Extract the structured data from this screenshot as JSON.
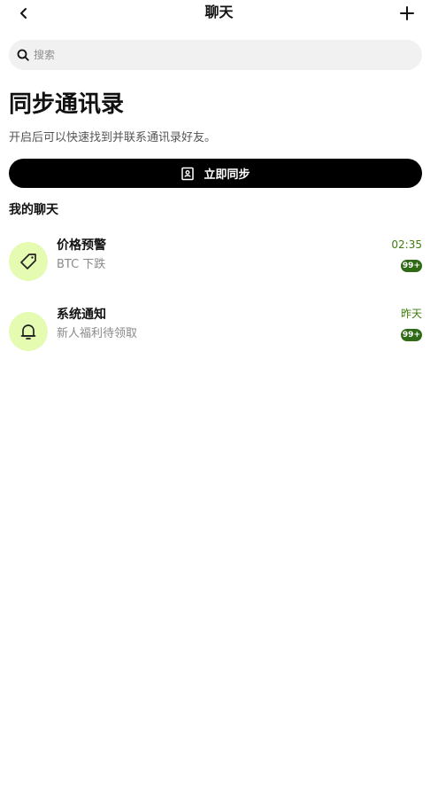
{
  "header": {
    "title": "聊天",
    "back_icon": "chevron-left-icon",
    "add_icon": "plus-icon"
  },
  "search": {
    "placeholder": "搜索",
    "value": "",
    "icon": "search-icon"
  },
  "sync": {
    "title": "同步通讯录",
    "description": "开启后可以快速找到并联系通讯录好友。",
    "button_label": "立即同步",
    "button_icon": "contact-book-icon"
  },
  "my_chats": {
    "title": "我的聊天",
    "items": [
      {
        "name": "价格预警",
        "preview": "BTC 下跌",
        "time": "02:35",
        "badge": "99+",
        "icon": "price-tag-icon"
      },
      {
        "name": "系统通知",
        "preview": "新人福利待领取",
        "time": "昨天",
        "badge": "99+",
        "icon": "bell-icon"
      }
    ]
  },
  "colors": {
    "accent_black": "#000000",
    "avatar_bg": "#e4fbb1",
    "time_green": "#3f7a0d",
    "badge_green": "#2f6a16",
    "search_bg": "#f1f1f1"
  }
}
